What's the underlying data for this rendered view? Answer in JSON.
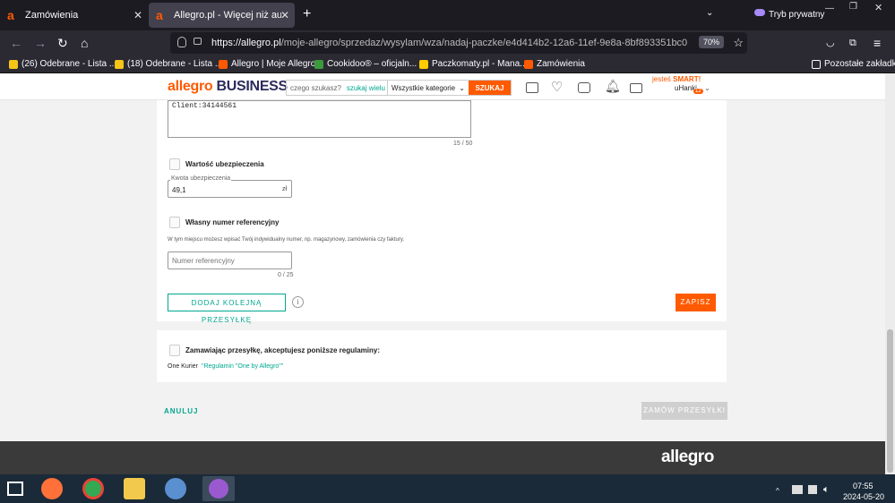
{
  "browser": {
    "tabs": [
      {
        "label": "Zamówienia"
      },
      {
        "label": "Allegro.pl - Więcej niż aukcje. N"
      }
    ],
    "private_label": "Tryb prywatny",
    "url_host": "https://allegro.pl",
    "url_path": "/moje-allegro/sprzedaz/wysylam/wza/nadaj-paczke/e4d414b2-12a6-11ef-9e8a-8bf893351bc0",
    "zoom": "70%",
    "bookmarks": [
      "(26) Odebrane - Lista ...",
      "(18) Odebrane - Lista ...",
      "Allegro | Moje Allegro",
      "Cookidoo® – oficjaln...",
      "Paczkomaty.pl - Mana...",
      "Zamówienia"
    ],
    "other_bookmarks": "Pozostałe zakładki"
  },
  "header": {
    "logo_a": "allegro",
    "logo_b": "BUSINESS",
    "search_placeholder": "czego szukasz?",
    "search_many": "szukaj wielu",
    "category": "Wszystkie kategorie",
    "search_button": "SZUKAJ",
    "smart_prefix": "jesteś",
    "smart": "SMART!",
    "username": "uHanki",
    "badge": "12"
  },
  "form": {
    "textarea_value": "Client:34144561",
    "textarea_count": "15 / 50",
    "insurance_title": "Wartość ubezpieczenia",
    "insurance_label": "Kwota ubezpieczenia",
    "insurance_value": "49,1",
    "insurance_unit": "zł",
    "ref_title": "Własny numer referencyjny",
    "ref_desc": "W tym miejscu możesz wpisać Twój indywidualny numer, np. magazynowy, zamówienia czy faktury.",
    "ref_placeholder": "Numer referencyjny",
    "ref_count": "0 / 25",
    "add_button": "DODAJ KOLEJNĄ PRZESYŁKĘ",
    "save_button": "ZAPISZ"
  },
  "terms": {
    "title": "Zamawiając przesyłkę, akceptujesz poniższe regulaminy:",
    "carrier": "One Kurier",
    "link": "\"Regulamin \"One by Allegro\"\""
  },
  "actions": {
    "cancel": "ANULUJ",
    "order": "ZAMÓW PRZESYŁKI"
  },
  "footer": {
    "logo": "allegro"
  },
  "taskbar": {
    "time": "07:55",
    "date": "2024-05-20"
  }
}
